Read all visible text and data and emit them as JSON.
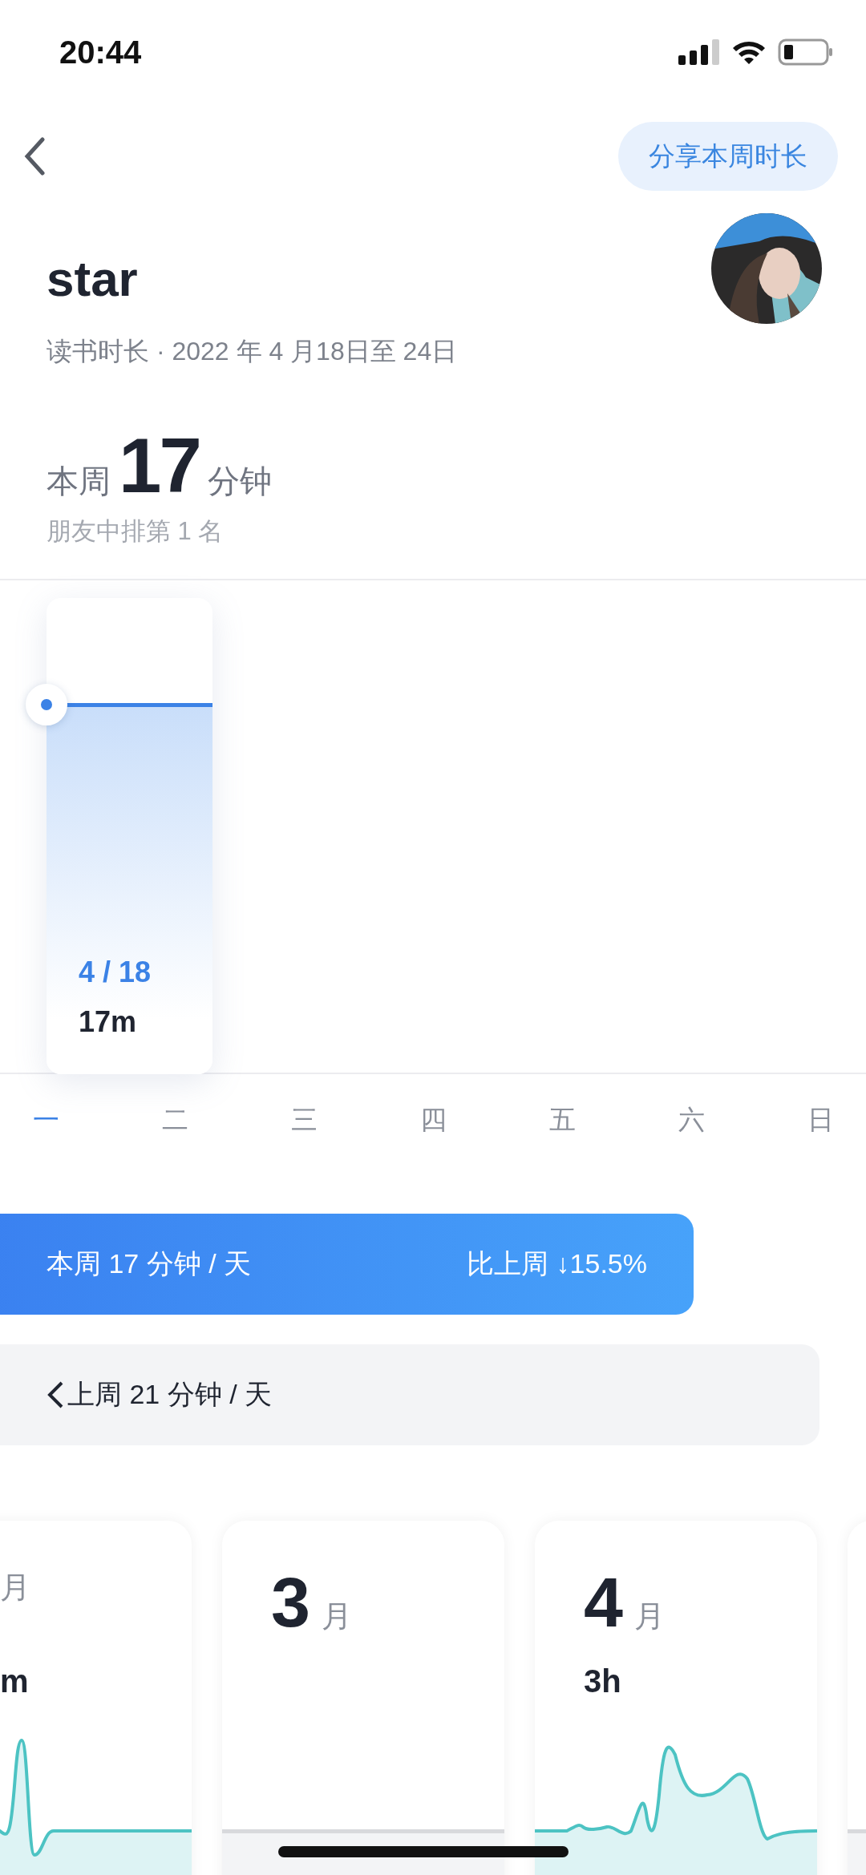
{
  "status_bar": {
    "time": "20:44"
  },
  "header": {
    "share_button": "分享本周时长"
  },
  "profile": {
    "name": "star",
    "subtitle": "读书时长 · 2022 年 4 月18日至 24日"
  },
  "weekly_total": {
    "prefix": "本周",
    "value": "17",
    "unit": "分钟",
    "rank": "朋友中排第 1 名"
  },
  "week_chart": {
    "selected_date": "4 / 18",
    "selected_value": "17m"
  },
  "weekdays": [
    {
      "label": "一",
      "selected": true
    },
    {
      "label": "二",
      "selected": false
    },
    {
      "label": "三",
      "selected": false
    },
    {
      "label": "四",
      "selected": false
    },
    {
      "label": "五",
      "selected": false
    },
    {
      "label": "六",
      "selected": false
    },
    {
      "label": "日",
      "selected": false
    }
  ],
  "this_week_bar": {
    "average": "本周 17 分钟 / 天",
    "change": "比上周 ↓15.5%"
  },
  "last_week_bar": {
    "average": "上周 21 分钟 / 天"
  },
  "month_cards": [
    {
      "kind": "activity",
      "unit": "月",
      "total": "m"
    },
    {
      "kind": "empty",
      "month": "3",
      "unit": "月"
    },
    {
      "kind": "activity",
      "month": "4",
      "unit": "月",
      "total": "3h"
    },
    {
      "kind": "empty"
    }
  ]
}
